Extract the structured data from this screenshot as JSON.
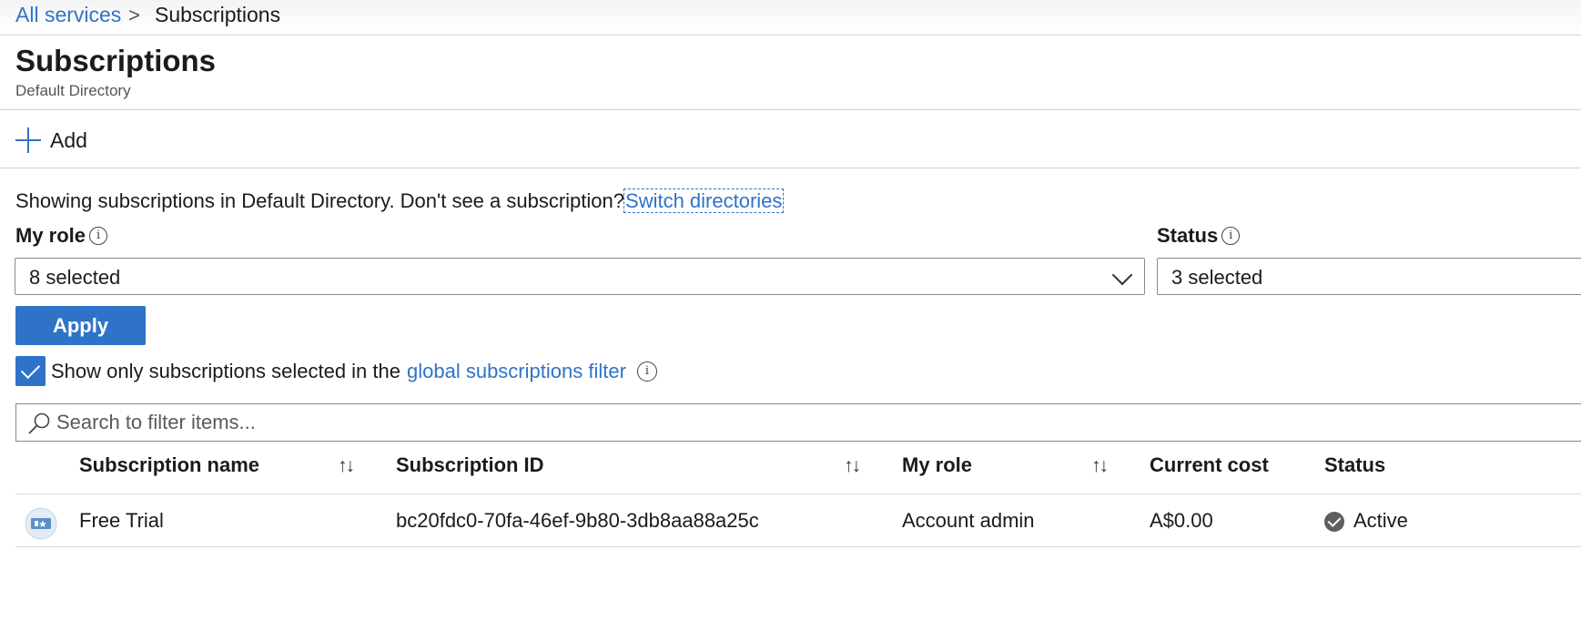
{
  "breadcrumb": {
    "root": "All services",
    "separator": ">",
    "current": "Subscriptions"
  },
  "header": {
    "title": "Subscriptions",
    "subtitle": "Default Directory"
  },
  "toolbar": {
    "add_label": "Add",
    "add_icon": "plus-icon"
  },
  "notice": {
    "text": "Showing subscriptions in Default Directory. Don't see a subscription?",
    "link": "Switch directories"
  },
  "filters": {
    "my_role": {
      "label": "My role",
      "value": "8 selected",
      "info_icon": "info-icon"
    },
    "status": {
      "label": "Status",
      "value": "3 selected",
      "info_icon": "info-icon"
    },
    "apply_label": "Apply"
  },
  "global_filter": {
    "checked": true,
    "text": "Show only subscriptions selected in the",
    "link": "global subscriptions filter",
    "info_icon": "info-icon"
  },
  "search": {
    "placeholder": "Search to filter items...",
    "value": ""
  },
  "table": {
    "columns": [
      "Subscription name",
      "Subscription ID",
      "My role",
      "Current cost",
      "Status"
    ],
    "sort_glyph": "↑↓",
    "rows": [
      {
        "icon": "subscription-icon",
        "name": "Free Trial",
        "id": "bc20fdc0-70fa-46ef-9b80-3db8aa88a25c",
        "role": "Account admin",
        "cost": "A$0.00",
        "status": "Active",
        "status_icon": "check-circle-icon"
      }
    ]
  },
  "colors": {
    "accent": "#2f73c8",
    "text": "#1b1b1b",
    "border": "#8a8a8a",
    "status_icon": "#5e5e5e"
  }
}
